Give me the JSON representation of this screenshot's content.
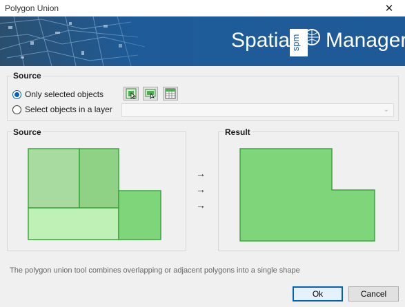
{
  "window": {
    "title": "Polygon Union",
    "close_glyph": "✕"
  },
  "banner": {
    "brand_left": "Spatial",
    "brand_mark": "spm",
    "brand_right": "Manager"
  },
  "source_group": {
    "title": "Source",
    "options": [
      {
        "label": "Only selected objects",
        "checked": true
      },
      {
        "label": "Select objects in a layer",
        "checked": false
      }
    ],
    "tools": [
      "select-objects-icon",
      "pick-objects-icon",
      "table-select-icon"
    ],
    "layer_select": {
      "value": "",
      "enabled": false
    }
  },
  "source_panel": {
    "title": "Source"
  },
  "result_panel": {
    "title": "Result"
  },
  "arrows": [
    "→",
    "→",
    "→"
  ],
  "note": "The polygon union tool combines overlapping or adjacent polygons into a single shape",
  "buttons": {
    "ok": "Ok",
    "cancel": "Cancel"
  },
  "colors": {
    "accent": "#0060c0",
    "banner_blue": "#1e5a96",
    "poly_light": "#a8dba0",
    "poly_mid": "#8fd286",
    "poly_pale": "#bff0b5",
    "poly_strong": "#7fd67a",
    "poly_border": "#3aa63e"
  }
}
